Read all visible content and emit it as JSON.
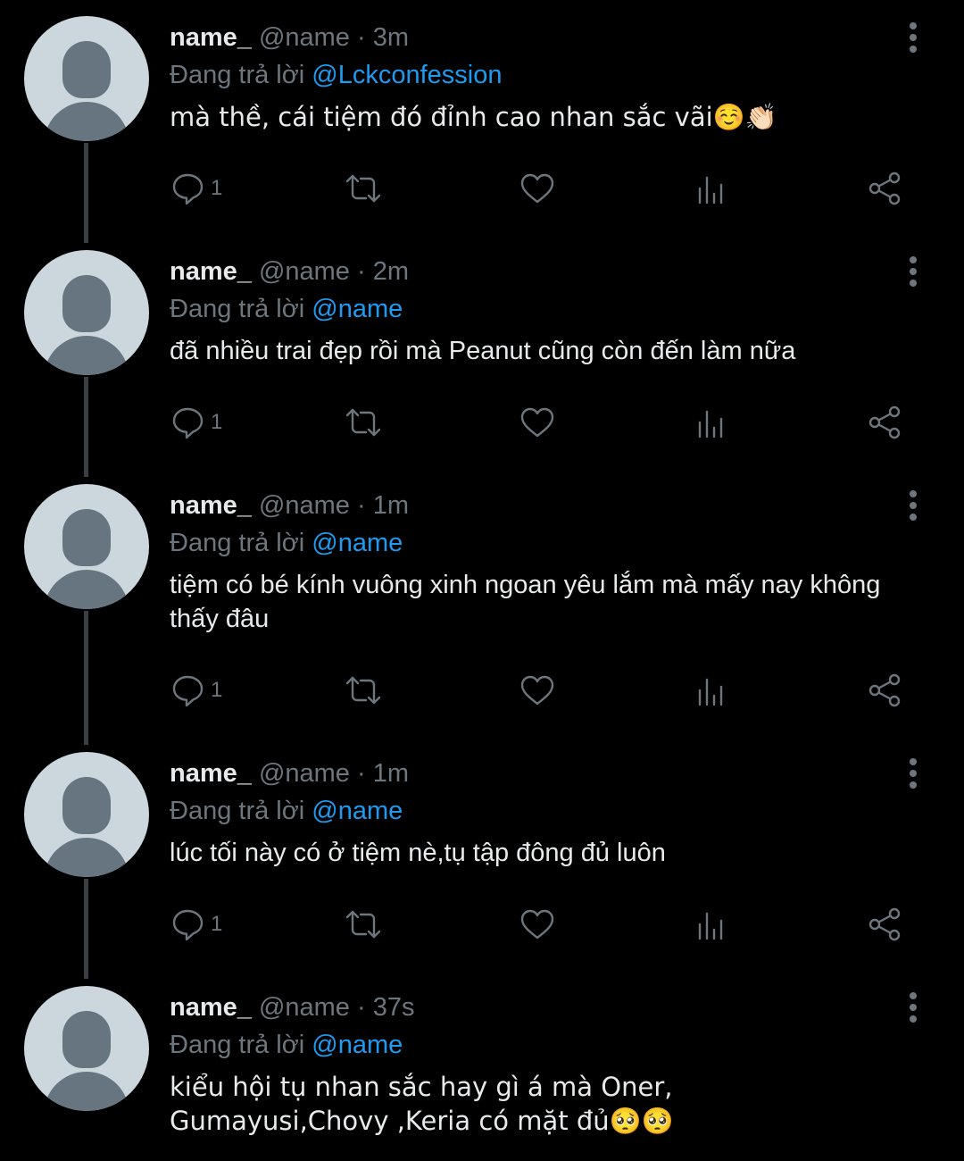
{
  "tweets": [
    {
      "display_name": "name_",
      "handle": "@name",
      "separator": "·",
      "time": "3m",
      "reply_prefix": "Đang trả lời",
      "reply_to": "@Lckconfession",
      "text": "mà thề, cái tiệm đó đỉnh cao nhan sắc vãi☺️👏🏻",
      "reply_count": "1"
    },
    {
      "display_name": "name_",
      "handle": "@name",
      "separator": "·",
      "time": "2m",
      "reply_prefix": "Đang trả lời",
      "reply_to": "@name",
      "text": "đã nhiều trai đẹp rồi mà Peanut cũng còn đến làm nữa",
      "reply_count": "1"
    },
    {
      "display_name": "name_",
      "handle": "@name",
      "separator": "·",
      "time": "1m",
      "reply_prefix": "Đang trả lời",
      "reply_to": "@name",
      "text": "tiệm có bé kính vuông xinh ngoan yêu lắm mà mấy nay không thấy đâu",
      "reply_count": "1"
    },
    {
      "display_name": "name_",
      "handle": "@name",
      "separator": "·",
      "time": "1m",
      "reply_prefix": "Đang trả lời",
      "reply_to": "@name",
      "text": "lúc tối này có ở tiệm nè,tụ tập đông đủ luôn",
      "reply_count": "1"
    },
    {
      "display_name": "name_",
      "handle": "@name",
      "separator": "·",
      "time": "37s",
      "reply_prefix": "Đang trả lời",
      "reply_to": "@name",
      "text": "kiểu hội tụ nhan sắc hay gì á mà Oner, Gumayusi,Chovy ,Keria có mặt đủ🥺🥺",
      "reply_count": ""
    }
  ],
  "icons": {
    "reply": "reply-icon",
    "retweet": "retweet-icon",
    "like": "heart-icon",
    "views": "analytics-icon",
    "share": "share-icon",
    "more": "more-vertical-icon"
  },
  "colors": {
    "background": "#000000",
    "text": "#e7e9ea",
    "muted": "#6e767d",
    "link": "#1d9bf0",
    "thread_line": "#3a3f44",
    "avatar_bg": "#ccd6dd",
    "avatar_fg": "#66757f"
  }
}
